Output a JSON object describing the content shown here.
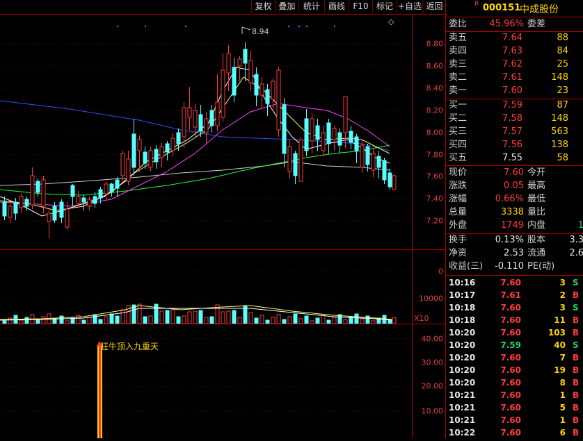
{
  "toolbar": {
    "items": [
      "复权",
      "叠加",
      "统计",
      "画线",
      "F10",
      "标记",
      "+自选",
      "返回"
    ]
  },
  "main_chart": {
    "peak_label": "8.94",
    "price_ticks": [
      "8.80",
      "8.60",
      "8.40",
      "8.20",
      "8.00",
      "7.80",
      "7.60",
      "7.40",
      "7.20"
    ],
    "diamond": "◇"
  },
  "volume_chart": {
    "ticks": [
      "0",
      "10000"
    ],
    "unit": "X10"
  },
  "indicator_chart": {
    "signal_label": "狂牛顶入九重天",
    "ticks": [
      "40.00",
      "30.00",
      "20.00",
      "10.00"
    ]
  },
  "stock": {
    "marker": "R",
    "code": "000151",
    "name": "中成股份",
    "weibi_label": "委比",
    "weibi_value": "45.96%",
    "weicha_label": "委差"
  },
  "asks": [
    {
      "label": "卖五",
      "price": "7.64",
      "vol": "88"
    },
    {
      "label": "卖四",
      "price": "7.63",
      "vol": "84"
    },
    {
      "label": "卖三",
      "price": "7.62",
      "vol": "25"
    },
    {
      "label": "卖二",
      "price": "7.61",
      "vol": "148"
    },
    {
      "label": "卖一",
      "price": "7.60",
      "vol": "23"
    }
  ],
  "bids": [
    {
      "label": "买一",
      "price": "7.59",
      "vol": "87"
    },
    {
      "label": "买二",
      "price": "7.58",
      "vol": "148"
    },
    {
      "label": "买三",
      "price": "7.57",
      "vol": "563"
    },
    {
      "label": "买四",
      "price": "7.56",
      "vol": "138"
    },
    {
      "label": "买五",
      "price": "7.55",
      "vol": "58"
    }
  ],
  "quote": [
    {
      "l1": "现价",
      "v1": "7.60",
      "l2": "今开",
      "v2": ""
    },
    {
      "l1": "涨跌",
      "v1": "0.05",
      "l2": "最高",
      "v2": ""
    },
    {
      "l1": "涨幅",
      "v1": "0.66%",
      "l2": "最低",
      "v2": ""
    },
    {
      "l1": "总量",
      "v1": "3338",
      "l2": "量比",
      "v2": ""
    },
    {
      "l1": "外盘",
      "v1": "1749",
      "l2": "内盘",
      "v2": "1"
    }
  ],
  "fundamentals": [
    {
      "l1": "换手",
      "v1": "0.13%",
      "l2": "股本",
      "v2": "3.3"
    },
    {
      "l1": "净资",
      "v1": "2.53",
      "l2": "流通",
      "v2": "2.6"
    },
    {
      "l1": "收益(三)",
      "v1": "-0.110",
      "l2": "PE(动)",
      "v2": ""
    }
  ],
  "ticks": [
    {
      "time": "10:16",
      "price": "7.60",
      "vol": "3",
      "side": "S"
    },
    {
      "time": "10:17",
      "price": "7.61",
      "vol": "2",
      "side": "B"
    },
    {
      "time": "10:18",
      "price": "7.60",
      "vol": "3",
      "side": "S"
    },
    {
      "time": "10:18",
      "price": "7.60",
      "vol": "11",
      "side": "B"
    },
    {
      "time": "10:20",
      "price": "7.60",
      "vol": "103",
      "side": "B"
    },
    {
      "time": "10:20",
      "price": "7.59",
      "vol": "40",
      "side": "S"
    },
    {
      "time": "10:20",
      "price": "7.60",
      "vol": "7",
      "side": "B"
    },
    {
      "time": "10:20",
      "price": "7.60",
      "vol": "19",
      "side": "B"
    },
    {
      "time": "10:20",
      "price": "7.60",
      "vol": "8",
      "side": "B"
    },
    {
      "time": "10:21",
      "price": "7.60",
      "vol": "1",
      "side": "B"
    },
    {
      "time": "10:21",
      "price": "7.60",
      "vol": "5",
      "side": "B"
    },
    {
      "time": "10:21",
      "price": "7.60",
      "vol": "1",
      "side": "B"
    },
    {
      "time": "10:22",
      "price": "7.60",
      "vol": "6",
      "side": "B"
    }
  ],
  "colors": {
    "up": "#ff3b3b",
    "down": "#54ffff",
    "grid": "#b00000",
    "ma5": "#ffffff",
    "ma10": "#ffff66",
    "ma20": "#ff40ff",
    "ma60": "#30ff30",
    "ma120": "#3050ff",
    "ma250": "#d0d0d0"
  }
}
